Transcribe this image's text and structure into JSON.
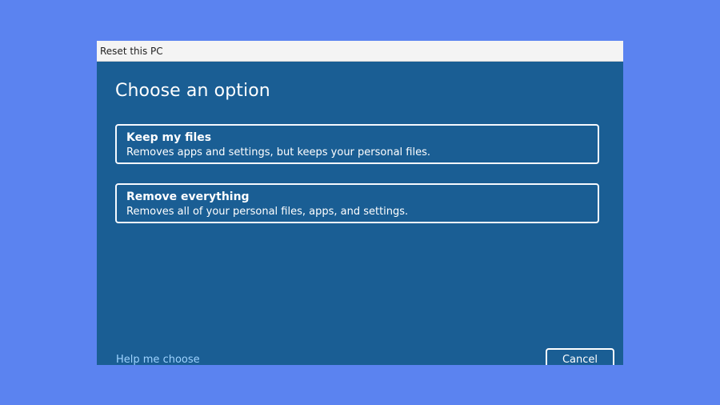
{
  "window": {
    "title": "Reset this PC"
  },
  "heading": "Choose an option",
  "options": [
    {
      "title": "Keep my files",
      "description": "Removes apps and settings, but keeps your personal files."
    },
    {
      "title": "Remove everything",
      "description": "Removes all of your personal files, apps, and settings."
    }
  ],
  "footer": {
    "help_link": "Help me choose",
    "cancel_label": "Cancel"
  },
  "colors": {
    "page_background": "#5b83f0",
    "dialog_background": "#1a5e94",
    "link": "#9ed3ff"
  }
}
